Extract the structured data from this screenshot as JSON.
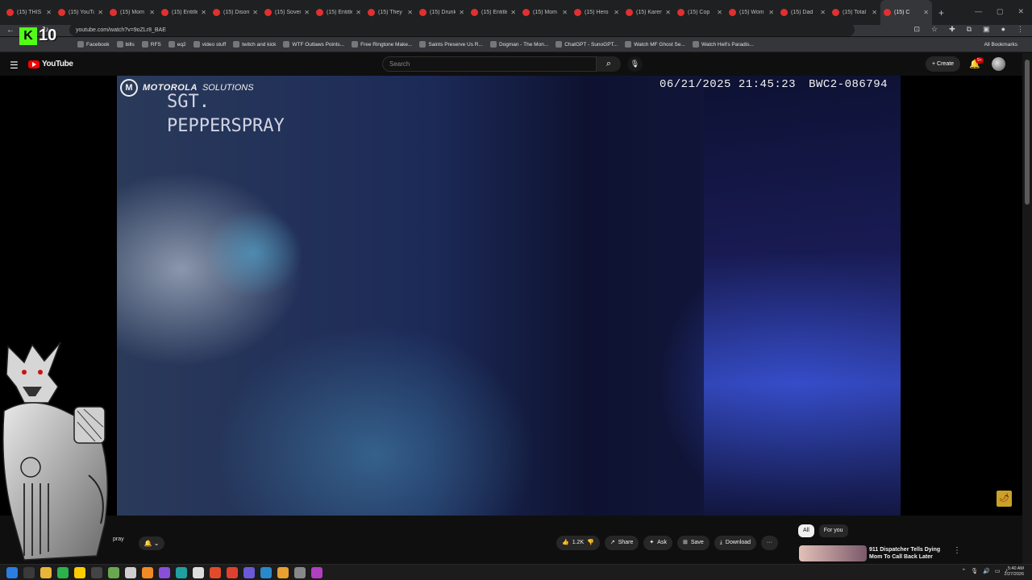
{
  "browser": {
    "tabs": [
      {
        "title": "(15) THIS I",
        "active": false
      },
      {
        "title": "(15) YouTu",
        "active": false
      },
      {
        "title": "(15) Mom",
        "active": false
      },
      {
        "title": "(15) Entitle",
        "active": false
      },
      {
        "title": "(15) Disori",
        "active": false
      },
      {
        "title": "(15) Sovere",
        "active": false
      },
      {
        "title": "(15) Entitle",
        "active": false
      },
      {
        "title": "(15) They",
        "active": false
      },
      {
        "title": "(15) Drunk",
        "active": false
      },
      {
        "title": "(15) Entitle",
        "active": false
      },
      {
        "title": "(15) Mom",
        "active": false
      },
      {
        "title": "(15) Hero",
        "active": false
      },
      {
        "title": "(15) Karen",
        "active": false
      },
      {
        "title": "(15) Cop",
        "active": false
      },
      {
        "title": "(15) Wom",
        "active": false
      },
      {
        "title": "(15) Dad",
        "active": false
      },
      {
        "title": "(15) Total",
        "active": false
      },
      {
        "title": "(15) C",
        "active": true
      }
    ],
    "new_tab": "+",
    "url": "youtube.com/watch?v=9oZLr8_BAE",
    "bookmarks": [
      "Facebook",
      "bills",
      "RFS",
      "eq2",
      "video stuff",
      "twitch and kick",
      "WTF Outlaws Points...",
      "Free Ringtone Make...",
      "Saints Preserve Us R...",
      "Dogman - The Mon...",
      "ChatGPT - SunoGPT...",
      "Watch MF Ghost Se...",
      "Watch Hell's Paradis..."
    ],
    "all_bookmarks": "All Bookmarks"
  },
  "youtube": {
    "logo_text": "YouTube",
    "search_placeholder": "Search",
    "create_label": "Create",
    "notif_count": "9+"
  },
  "video": {
    "brand_mark": "M",
    "brand_prefix": "MOTOROLA",
    "brand_suffix": "SOLUTIONS",
    "channel_overlay_line1": "SGT.",
    "channel_overlay_line2": "PEPPERSPRAY",
    "timestamp": "06/21/2025 21:45:23",
    "camera_id": "BWC2-086794"
  },
  "below_video": {
    "channel_name_partial": "pray",
    "like_count": "1.2K",
    "share_label": "Share",
    "ask_label": "Ask",
    "save_label": "Save",
    "download_label": "Download",
    "more_label": "···"
  },
  "sidebar": {
    "chips": [
      {
        "label": "All",
        "selected": true
      },
      {
        "label": "For you",
        "selected": false
      }
    ],
    "recommendation_title": "911 Dispatcher Tells Dying Mom To Call Back Later"
  },
  "stream_overlay": {
    "logo": "K",
    "number": "10"
  },
  "taskbar": {
    "time": "5:40 AM",
    "date": "2/27/2026"
  },
  "colors": {
    "yt_red": "#ff0000",
    "kick_green": "#53fc18",
    "bg": "#0f0f0f"
  }
}
